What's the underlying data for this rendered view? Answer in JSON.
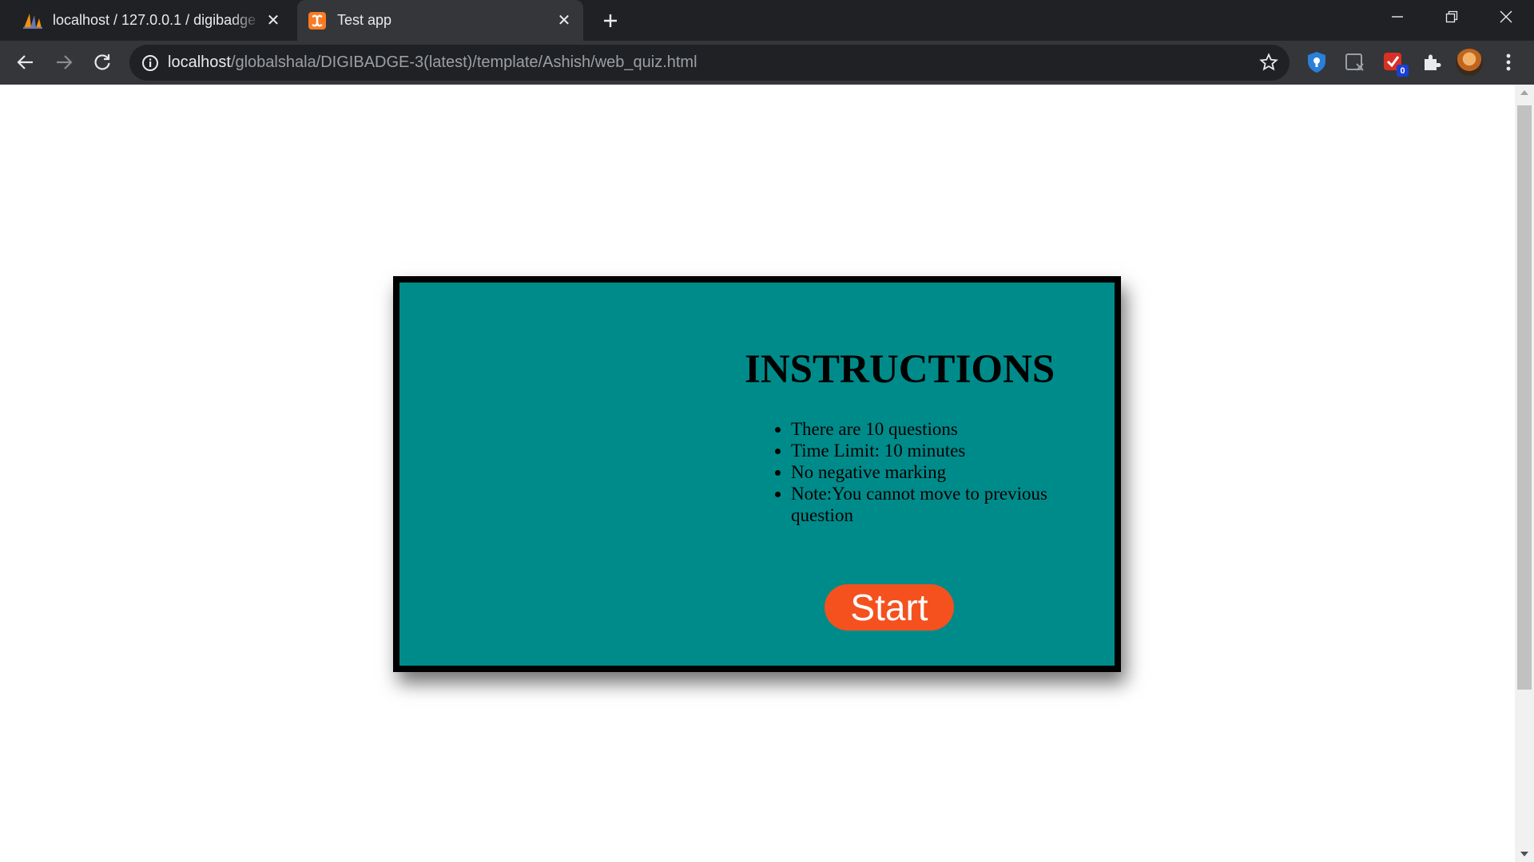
{
  "browser": {
    "tabs": [
      {
        "title": "localhost / 127.0.0.1 / digibadge",
        "favicon": "phpmyadmin-sail-icon",
        "active": false
      },
      {
        "title": "Test app",
        "favicon": "xampp-icon",
        "active": true
      }
    ],
    "url": {
      "host": "localhost",
      "path": "/globalshala/DIGIBADGE-3(latest)/template/Ashish/web_quiz.html"
    },
    "extension_badge": "0",
    "icons": [
      "back-icon",
      "forward-icon",
      "reload-icon",
      "info-icon",
      "star-icon",
      "extension-icon",
      "puzzle-icon",
      "menu-icon"
    ]
  },
  "quiz": {
    "title": "INSTRUCTIONS",
    "instructions": [
      "There are 10 questions",
      "Time Limit: 10 minutes",
      "No negative marking",
      "Note:You cannot move to previous question"
    ],
    "start_label": "Start"
  },
  "colors": {
    "card_background": "#008b8b",
    "card_border": "#000000",
    "start_button": "#f4511e",
    "chrome_dark": "#202124",
    "chrome_toolbar": "#35363a"
  }
}
